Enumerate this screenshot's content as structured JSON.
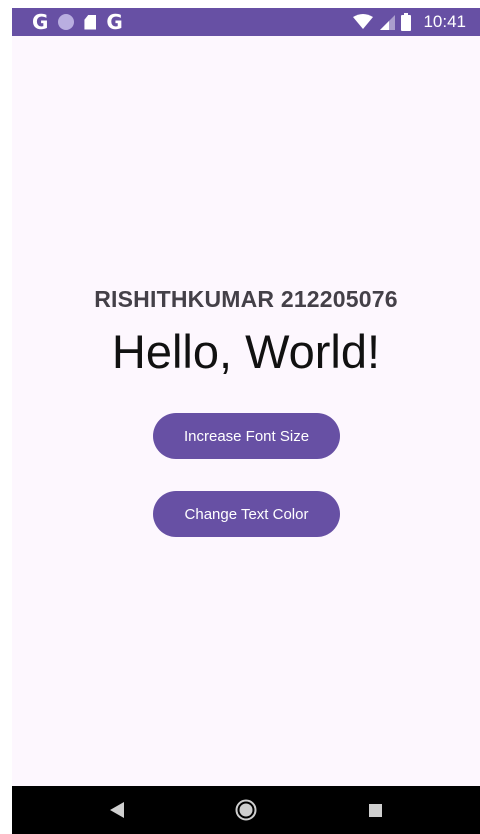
{
  "status_bar": {
    "left_icons": [
      "google-icon",
      "circle-icon",
      "sd-card-icon",
      "google-icon"
    ],
    "google_glyph": "G",
    "time": "10:41",
    "color": "#6750a4"
  },
  "main": {
    "name_label": "RISHITHKUMAR 212205076",
    "hello_text": "Hello, World!",
    "increase_button_label": "Increase Font Size",
    "color_button_label": "Change Text Color",
    "accent_color": "#6750a4",
    "background_color": "#fdf7fe"
  },
  "nav_bar": {
    "icons": [
      "back-icon",
      "home-icon",
      "recents-icon"
    ]
  }
}
